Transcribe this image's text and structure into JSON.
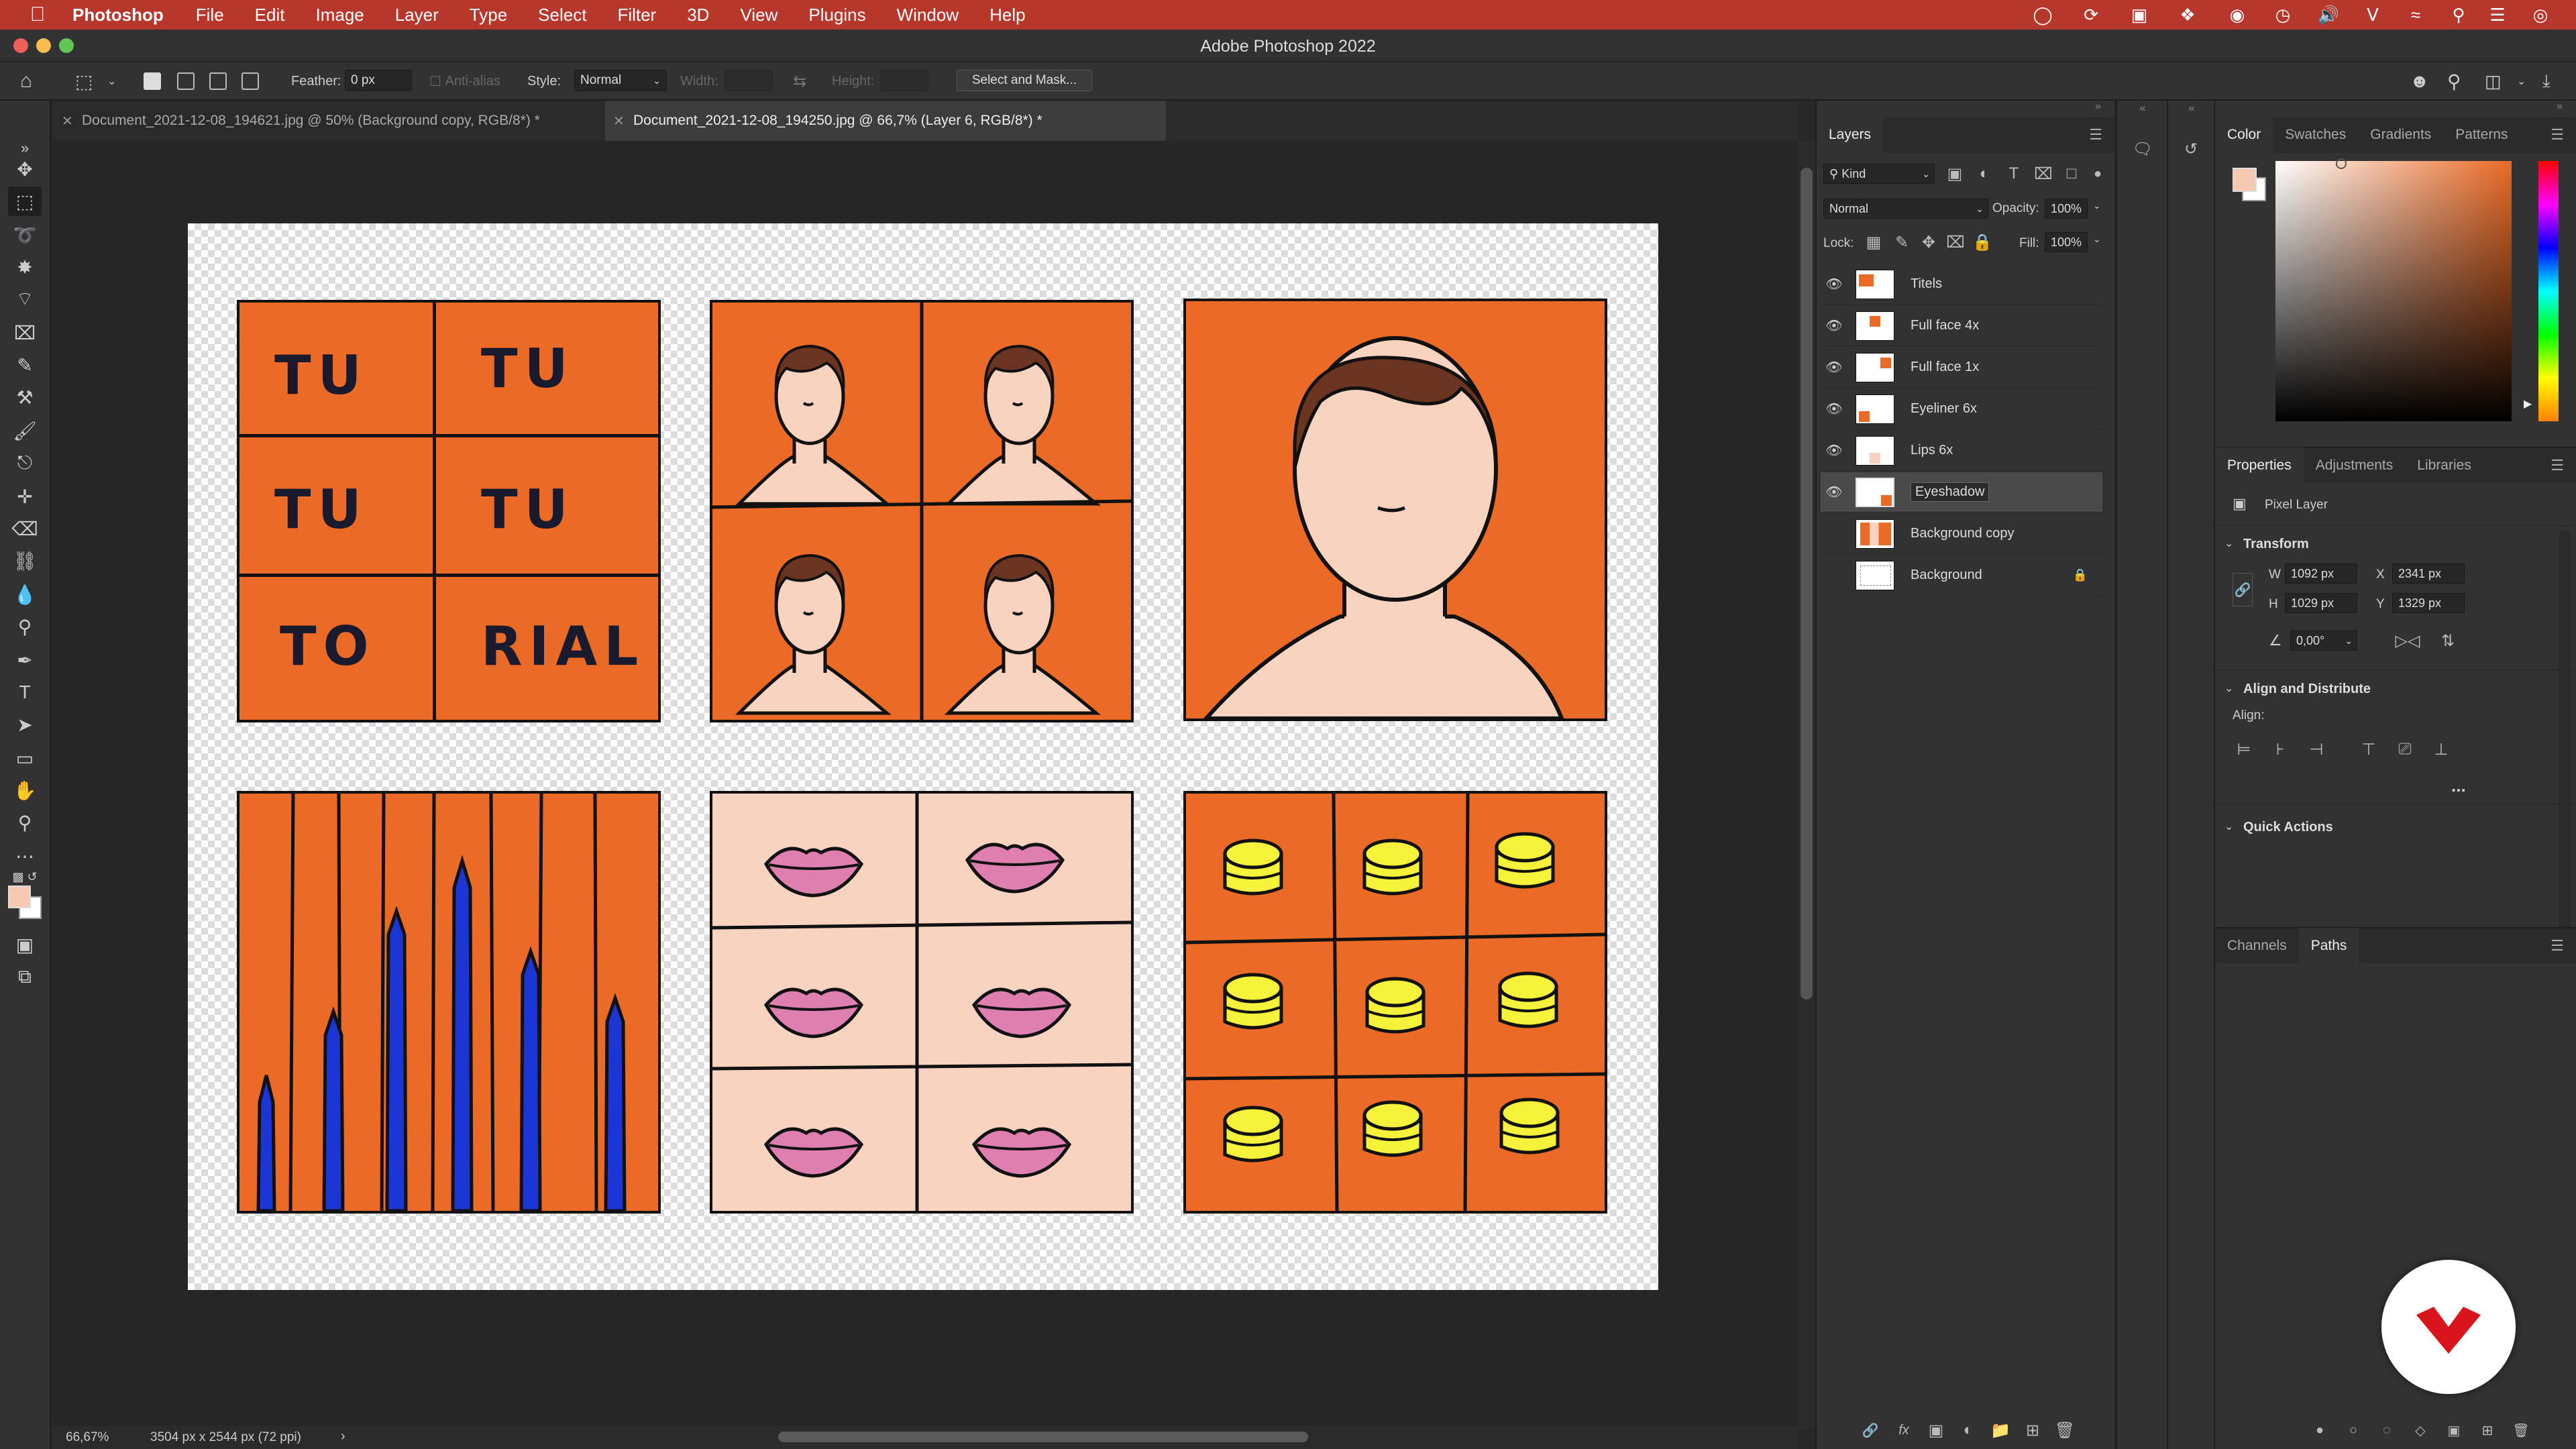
{
  "menubar": {
    "apple_icon": "apple-logo-icon",
    "app_name": "Photoshop",
    "items": [
      "File",
      "Edit",
      "Image",
      "Layer",
      "Type",
      "Select",
      "Filter",
      "3D",
      "View",
      "Plugins",
      "Window",
      "Help"
    ]
  },
  "window": {
    "title": "Adobe Photoshop 2022"
  },
  "options": {
    "feather_label": "Feather:",
    "feather_value": "0 px",
    "antialias_label": "Anti-alias",
    "style_label": "Style:",
    "style_value": "Normal",
    "width_label": "Width:",
    "height_label": "Height:",
    "select_mask_label": "Select and Mask..."
  },
  "tabs": [
    {
      "label": "Document_2021-12-08_194621.jpg @ 50% (Background copy, RGB/8*) *",
      "active": false
    },
    {
      "label": "Document_2021-12-08_194250.jpg @ 66,7% (Layer 6, RGB/8*) *",
      "active": true
    }
  ],
  "artwork": {
    "tutorial_words": [
      "TU",
      "TU",
      "TU",
      "TU",
      "TO",
      "RIAL"
    ]
  },
  "status": {
    "zoom": "66,67%",
    "doc_size": "3504 px x 2544 px (72 ppi)"
  },
  "layers_panel": {
    "title": "Layers",
    "filter_kind": "Kind",
    "blend_mode": "Normal",
    "opacity_label": "Opacity:",
    "opacity_value": "100%",
    "lock_label": "Lock:",
    "fill_label": "Fill:",
    "fill_value": "100%",
    "layers": [
      {
        "name": "Titels",
        "visible": true
      },
      {
        "name": "Full face 4x",
        "visible": true
      },
      {
        "name": "Full face 1x",
        "visible": true
      },
      {
        "name": "Eyeliner 6x",
        "visible": true
      },
      {
        "name": "Lips 6x",
        "visible": true
      },
      {
        "name": "Eyeshadow",
        "visible": true,
        "selected": true
      },
      {
        "name": "Background copy",
        "visible": false
      },
      {
        "name": "Background",
        "visible": false,
        "locked": true
      }
    ]
  },
  "color_panel": {
    "tabs": [
      "Color",
      "Swatches",
      "Gradients",
      "Patterns"
    ],
    "foreground": "#f6c9b0",
    "background": "#ffffff"
  },
  "properties_panel": {
    "tabs": [
      "Properties",
      "Adjustments",
      "Libraries"
    ],
    "layer_type": "Pixel Layer",
    "transform_title": "Transform",
    "w_label": "W",
    "w_value": "1092 px",
    "h_label": "H",
    "h_value": "1029 px",
    "x_label": "X",
    "x_value": "2341 px",
    "y_label": "Y",
    "y_value": "1329 px",
    "angle_value": "0,00°",
    "align_title": "Align and Distribute",
    "align_label": "Align:",
    "more_label": "...",
    "quick_actions_title": "Quick Actions"
  },
  "paths_panel": {
    "tabs": [
      "Channels",
      "Paths"
    ]
  },
  "colors": {
    "menubar": "#b8372d",
    "orange": "#ea6a26",
    "skin": "#f8d3c0",
    "hair": "#6b3420",
    "lips": "#df7fb0",
    "pencil": "#1c36d6",
    "yellow": "#f6f23c",
    "logo_red": "#d9141c"
  }
}
